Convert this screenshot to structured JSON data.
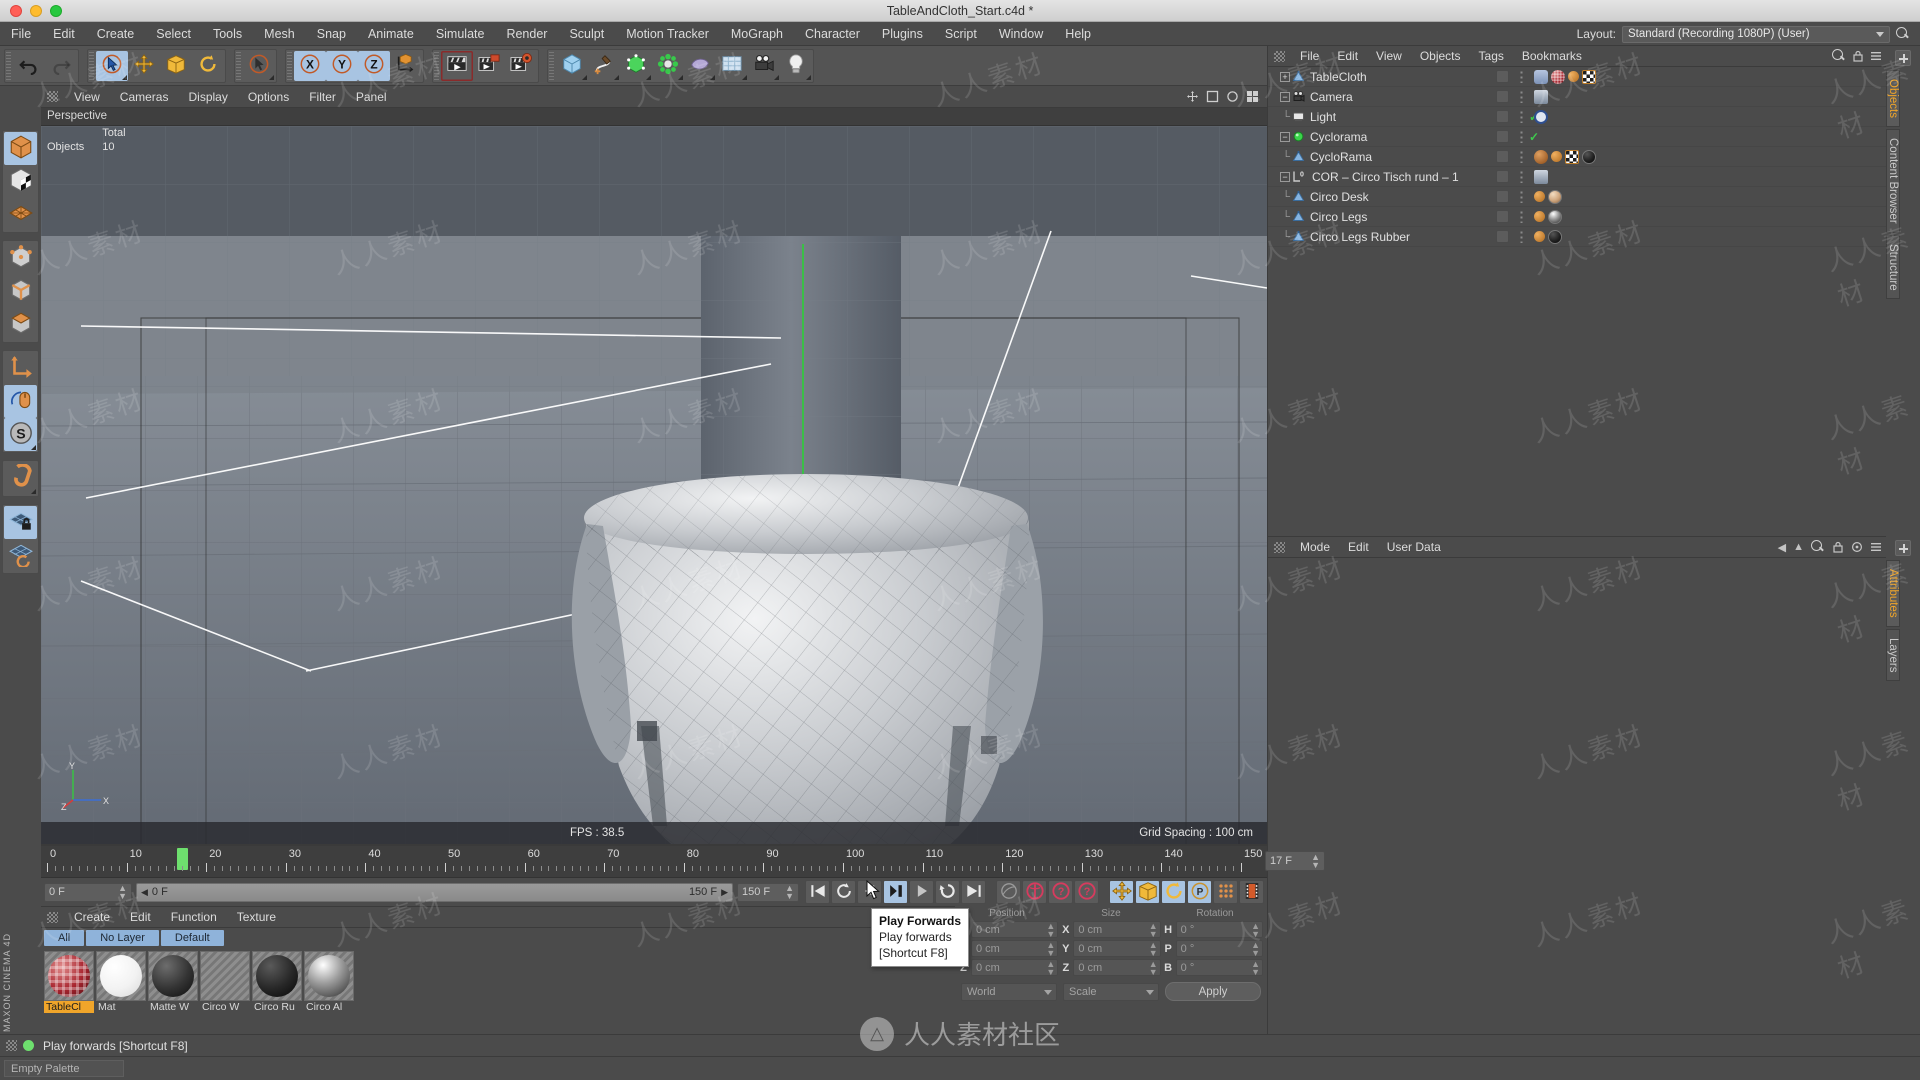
{
  "window": {
    "title": "TableAndCloth_Start.c4d *",
    "traffic_lights": [
      "close",
      "minimize",
      "zoom"
    ]
  },
  "menubar": {
    "items": [
      "File",
      "Edit",
      "Create",
      "Select",
      "Tools",
      "Mesh",
      "Snap",
      "Animate",
      "Simulate",
      "Render",
      "Sculpt",
      "Motion Tracker",
      "MoGraph",
      "Character",
      "Plugins",
      "Script",
      "Window",
      "Help"
    ],
    "layout_label": "Layout:",
    "layout_value": "Standard (Recording 1080P) (User)",
    "search_icon": "search-icon"
  },
  "toolbar": {
    "groups": [
      {
        "name": "history",
        "buttons": [
          {
            "name": "undo-button",
            "icon": "undo-icon",
            "selected": false
          },
          {
            "name": "redo-button",
            "icon": "redo-icon",
            "selected": false
          }
        ]
      },
      {
        "name": "selection-transform",
        "buttons": [
          {
            "name": "live-selection-button",
            "icon": "live-selection-icon",
            "selected": true,
            "corner": true
          },
          {
            "name": "move-button",
            "icon": "move-icon",
            "selected": false
          },
          {
            "name": "scale-button",
            "icon": "scale-icon",
            "selected": false
          },
          {
            "name": "rotate-button",
            "icon": "rotate-icon",
            "selected": false
          }
        ]
      },
      {
        "name": "select-mode",
        "buttons": [
          {
            "name": "select-tool-button",
            "icon": "arrow-cursor-icon",
            "selected": false,
            "corner": true
          }
        ]
      },
      {
        "name": "axis-locks",
        "buttons": [
          {
            "name": "lock-x-button",
            "icon": "axis-x-icon",
            "selected": true
          },
          {
            "name": "lock-y-button",
            "icon": "axis-y-icon",
            "selected": true
          },
          {
            "name": "lock-z-button",
            "icon": "axis-z-icon",
            "selected": true
          },
          {
            "name": "coordinate-system-button",
            "icon": "world-coordinates-icon",
            "selected": false
          }
        ]
      },
      {
        "name": "render",
        "buttons": [
          {
            "name": "render-view-button",
            "icon": "render-view-icon",
            "selected": false,
            "active": true
          },
          {
            "name": "render-to-picture-viewer-button",
            "icon": "render-picture-icon",
            "selected": false
          },
          {
            "name": "render-settings-button",
            "icon": "render-settings-icon",
            "selected": false
          }
        ]
      },
      {
        "name": "create",
        "buttons": [
          {
            "name": "add-cube-button",
            "icon": "cube-icon",
            "selected": false,
            "corner": true
          },
          {
            "name": "add-spline-button",
            "icon": "spline-pen-icon",
            "selected": false,
            "corner": true
          },
          {
            "name": "add-generator-button",
            "icon": "nurbs-generator-icon",
            "selected": false,
            "corner": true
          },
          {
            "name": "add-mograph-button",
            "icon": "mograph-cloner-icon",
            "selected": false,
            "corner": true
          },
          {
            "name": "add-deformer-button",
            "icon": "deformer-icon",
            "selected": false,
            "corner": true
          },
          {
            "name": "add-scene-button",
            "icon": "floor-scene-icon",
            "selected": false,
            "corner": true
          },
          {
            "name": "add-camera-button",
            "icon": "camera-icon",
            "selected": false,
            "corner": true
          },
          {
            "name": "add-light-button",
            "icon": "light-bulb-icon",
            "selected": false,
            "corner": true
          }
        ]
      }
    ]
  },
  "left_toolbar": {
    "groups": [
      [
        {
          "name": "model-mode-button",
          "icon": "model-cube-icon",
          "selected": true
        },
        {
          "name": "texture-mode-button",
          "icon": "texture-cube-icon",
          "selected": false
        },
        {
          "name": "workplane-mode-button",
          "icon": "workplane-grid-icon",
          "selected": false
        }
      ],
      [
        {
          "name": "point-mode-button",
          "icon": "points-cube-icon",
          "selected": false
        },
        {
          "name": "edge-mode-button",
          "icon": "edges-cube-icon",
          "selected": false
        },
        {
          "name": "polygon-mode-button",
          "icon": "polygon-cube-icon",
          "selected": false
        }
      ],
      [
        {
          "name": "object-axis-button",
          "icon": "axis-l-icon",
          "selected": false
        },
        {
          "name": "viewport-solo-button",
          "icon": "mouse-icon",
          "selected": true
        },
        {
          "name": "enable-axis-button",
          "icon": "s-circle-icon",
          "selected": true,
          "corner": true
        }
      ],
      [
        {
          "name": "snap-magnet-button",
          "icon": "magnet-icon",
          "selected": false,
          "corner": true
        }
      ],
      [
        {
          "name": "lock-workplane-button",
          "icon": "grid-lock-icon",
          "selected": true
        },
        {
          "name": "workplane-rotate-button",
          "icon": "grid-rotate-icon",
          "selected": false
        }
      ]
    ],
    "brand": "MAXON CINEMA 4D"
  },
  "viewport": {
    "menu": [
      "View",
      "Cameras",
      "Display",
      "Options",
      "Filter",
      "Panel"
    ],
    "label": "Perspective",
    "stats": {
      "header": "Total",
      "row_label": "Objects",
      "row_value": "10"
    },
    "fps": "FPS : 38.5",
    "grid_spacing": "Grid Spacing : 100 cm",
    "axis_labels": {
      "y": "Y",
      "x": "X",
      "z": "Z"
    }
  },
  "timeline": {
    "ruler_labels": [
      "0",
      "10",
      "20",
      "30",
      "40",
      "50",
      "60",
      "70",
      "80",
      "90",
      "100",
      "110",
      "120",
      "130",
      "140",
      "150"
    ],
    "playhead_frame": 17,
    "start_frame_field": "0 F",
    "range_start": "0 F",
    "range_end": "150 F",
    "end_frame_field": "150 F",
    "current_frame_field": "17 F",
    "transport": [
      {
        "name": "go-to-start-button",
        "icon": "skip-start-icon",
        "selected": false
      },
      {
        "name": "loop-button",
        "icon": "loop-icon",
        "selected": false
      },
      {
        "name": "previous-frame-button",
        "icon": "step-back-icon",
        "selected": false
      },
      {
        "name": "play-forwards-button",
        "icon": "play-pause-icon",
        "selected": true
      },
      {
        "name": "next-frame-button",
        "icon": "step-forward-icon",
        "selected": false
      },
      {
        "name": "play-reverse-button",
        "icon": "play-reverse-icon",
        "selected": false
      },
      {
        "name": "go-to-end-button",
        "icon": "skip-end-icon",
        "selected": false
      }
    ],
    "record_tools": [
      {
        "name": "record-active-objects-button",
        "icon": "record-dot-icon",
        "selected": false
      },
      {
        "name": "autokeying-button",
        "icon": "autokey-icon",
        "selected": false
      },
      {
        "name": "keyframe-position-button",
        "icon": "key-position-icon",
        "selected": false
      },
      {
        "name": "keyframe-help-button",
        "icon": "key-question-icon",
        "selected": false
      }
    ],
    "param_tools": [
      {
        "name": "key-position-toggle",
        "icon": "move-icon",
        "selected": true
      },
      {
        "name": "key-scale-toggle",
        "icon": "scale-icon",
        "selected": true
      },
      {
        "name": "key-rotation-toggle",
        "icon": "rotate-icon",
        "selected": true
      },
      {
        "name": "key-pla-toggle",
        "icon": "pla-icon",
        "selected": true
      },
      {
        "name": "key-point-level-toggle",
        "icon": "point-level-icon",
        "selected": false
      },
      {
        "name": "timeline-button",
        "icon": "film-strip-icon",
        "selected": false
      }
    ]
  },
  "material_manager": {
    "menu": [
      "Create",
      "Edit",
      "Function",
      "Texture"
    ],
    "layers": [
      "All",
      "No Layer",
      "Default"
    ],
    "materials": [
      {
        "name": "TableCl",
        "selected": true,
        "preview": "checkered-red"
      },
      {
        "name": "Mat",
        "selected": false,
        "preview": "white"
      },
      {
        "name": "Matte W",
        "selected": false,
        "preview": "dark"
      },
      {
        "name": "Circo W",
        "selected": false,
        "preview": "tan"
      },
      {
        "name": "Circo Ru",
        "selected": false,
        "preview": "black"
      },
      {
        "name": "Circo Al",
        "selected": false,
        "preview": "metal"
      }
    ]
  },
  "coordinates": {
    "headers": [
      "Position",
      "Size",
      "Rotation"
    ],
    "rows": [
      {
        "k1": "X",
        "v1": "0 cm",
        "k2": "X",
        "v2": "0 cm",
        "k3": "H",
        "v3": "0 °"
      },
      {
        "k1": "Y",
        "v1": "0 cm",
        "k2": "Y",
        "v2": "0 cm",
        "k3": "P",
        "v3": "0 °"
      },
      {
        "k1": "Z",
        "v1": "0 cm",
        "k2": "Z",
        "v2": "0 cm",
        "k3": "B",
        "v3": "0 °"
      }
    ],
    "system_dropdown": "World",
    "mode_dropdown": "Scale",
    "apply_button": "Apply"
  },
  "object_manager": {
    "menu": [
      "File",
      "Edit",
      "View",
      "Objects",
      "Tags",
      "Bookmarks"
    ],
    "objects": [
      {
        "label": "TableCloth",
        "indent": 0,
        "expander": "+",
        "icon": "polygon-object-icon",
        "tags": [
          "deformer-tag",
          "cloth-material-tag",
          "cloth-tag",
          "texture-tag"
        ]
      },
      {
        "label": "Camera",
        "indent": 0,
        "expander": "-",
        "icon": "camera-object-icon",
        "tags": [
          "protection-tag"
        ]
      },
      {
        "label": "Light",
        "indent": 1,
        "expander": "",
        "icon": "light-object-icon",
        "tags": [
          "target-tag"
        ],
        "check": true
      },
      {
        "label": "Cyclorama",
        "indent": 0,
        "expander": "-",
        "icon": "null-object-icon",
        "tags": [],
        "check": true
      },
      {
        "label": "CycloRama",
        "indent": 1,
        "expander": "",
        "icon": "polygon-object-icon",
        "tags": [
          "bake-tag",
          "material-tag",
          "texture-tag",
          "black-material-tag"
        ]
      },
      {
        "label": "COR – Circo Tisch rund – 1",
        "indent": 0,
        "expander": "-",
        "icon": "layer-zero-icon",
        "tags": [
          "xref-tag"
        ]
      },
      {
        "label": "Circo Desk",
        "indent": 1,
        "expander": "",
        "icon": "polygon-object-icon",
        "tags": [
          "material-tag",
          "tan-material-tag"
        ]
      },
      {
        "label": "Circo Legs",
        "indent": 1,
        "expander": "",
        "icon": "polygon-object-icon",
        "tags": [
          "material-tag",
          "metal-material-tag"
        ]
      },
      {
        "label": "Circo Legs Rubber",
        "indent": 1,
        "expander": "",
        "icon": "polygon-object-icon",
        "tags": [
          "material-tag",
          "black-material-tag"
        ]
      }
    ]
  },
  "attribute_manager": {
    "menu": [
      "Mode",
      "Edit",
      "User Data"
    ],
    "icons": [
      "back-arrow-icon",
      "forward-arrow-icon",
      "search-icon",
      "lock-icon",
      "pin-icon",
      "menu-icon"
    ]
  },
  "right_tabs": {
    "upper": [
      {
        "label": "Objects",
        "active": true
      },
      {
        "label": "Content Browser",
        "active": false
      },
      {
        "label": "Structure",
        "active": false
      }
    ],
    "lower": [
      {
        "label": "Attributes",
        "active": true
      },
      {
        "label": "Layers",
        "active": false
      }
    ]
  },
  "tooltip": {
    "title": "Play Forwards",
    "description": "Play forwards",
    "shortcut": "[Shortcut F8]"
  },
  "statusbar": {
    "message": "Play forwards [Shortcut F8]",
    "indicator": "green",
    "palette_label": "Empty Palette"
  },
  "watermark": {
    "text": "人人素材社区",
    "small": "人人素材"
  },
  "colors": {
    "accent_orange": "#f0a52a",
    "selected_blue": "#a8c4e2",
    "panel_bg": "#4b4b4b",
    "toolbar_bg": "#545454",
    "green": "#6ee06e"
  }
}
